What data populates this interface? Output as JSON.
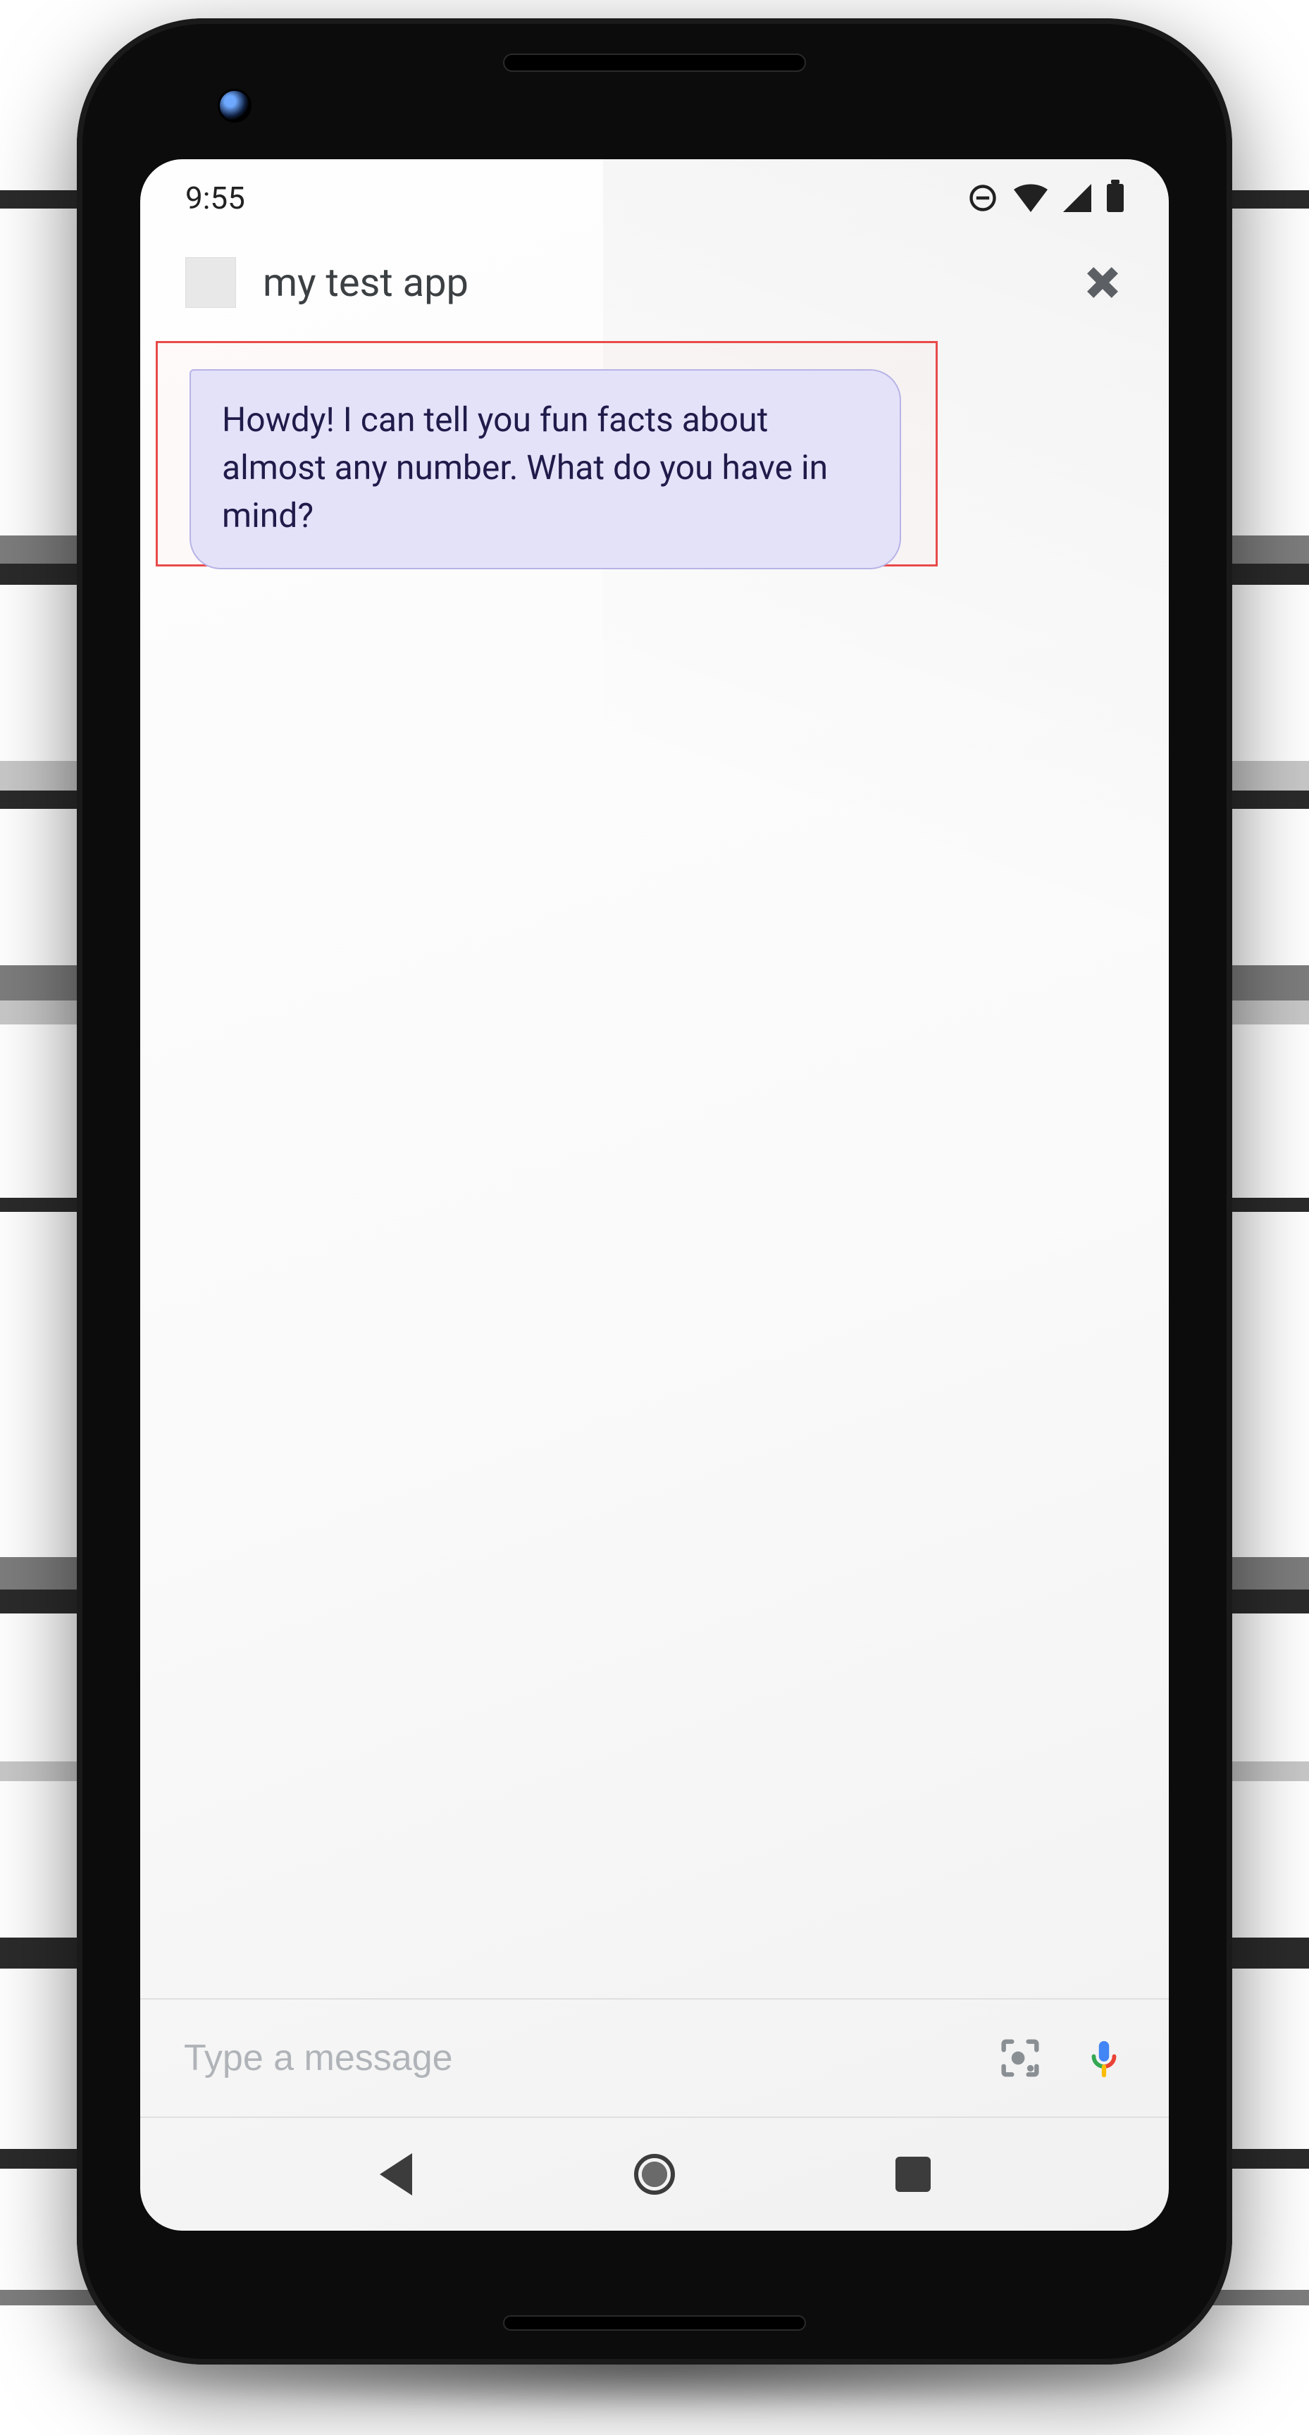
{
  "status": {
    "time": "9:55"
  },
  "header": {
    "app_title": "my test app",
    "close_label": "Close"
  },
  "conversation": {
    "messages": [
      {
        "from": "assistant",
        "text": "Howdy! I can tell you fun facts about almost any number. What do you have in mind?"
      }
    ]
  },
  "compose": {
    "placeholder": "Type a message"
  },
  "icons": {
    "dnd": "do-not-disturb-icon",
    "wifi": "wifi-icon",
    "signal": "cellular-signal-icon",
    "battery": "battery-icon",
    "app": "app-icon",
    "close": "close-icon",
    "lens": "google-lens-icon",
    "mic": "microphone-icon",
    "nav_back": "nav-back-icon",
    "nav_home": "nav-home-icon",
    "nav_recent": "nav-recent-icon"
  },
  "colors": {
    "bubble_bg": "#e4e2f9",
    "bubble_border": "#b7b3e6",
    "bubble_text": "#1f1b4a",
    "highlight": "#e94a4a"
  }
}
